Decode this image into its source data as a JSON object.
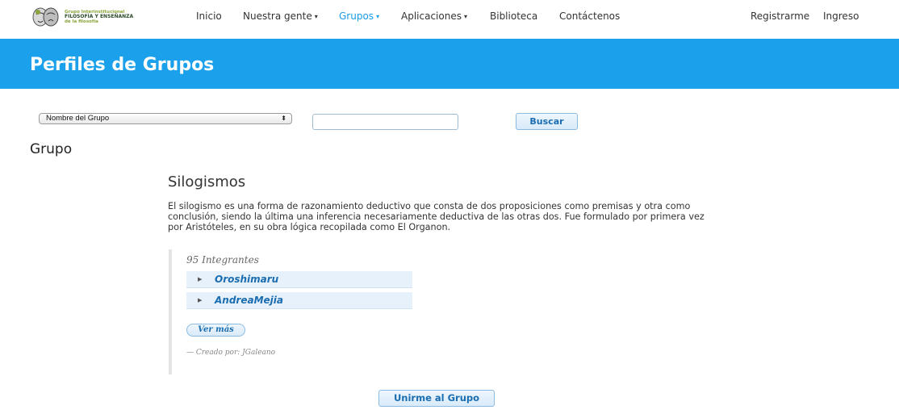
{
  "header": {
    "logo": {
      "line1": "Grupo Interinstitucional",
      "line2": "FILOSOFÍA Y ENSEÑANZA",
      "line3": "de la filosofía"
    },
    "nav": [
      {
        "label": "Inicio",
        "dropdown": false,
        "active": false
      },
      {
        "label": "Nuestra gente",
        "dropdown": true,
        "active": false
      },
      {
        "label": "Grupos",
        "dropdown": true,
        "active": true
      },
      {
        "label": "Aplicaciones",
        "dropdown": true,
        "active": false
      },
      {
        "label": "Biblioteca",
        "dropdown": false,
        "active": false
      },
      {
        "label": "Contáctenos",
        "dropdown": false,
        "active": false
      }
    ],
    "register_label": "Registrarme",
    "login_label": "Ingreso",
    "active_color": "#1a9be8"
  },
  "banner": {
    "title": "Perfiles de Grupos",
    "color": "#1ba1ec"
  },
  "search": {
    "filter_selected": "Nombre del Grupo",
    "query_value": "",
    "button_label": "Buscar"
  },
  "section": {
    "heading": "Grupo"
  },
  "group": {
    "title": "Silogismos",
    "description": "El silogismo es una forma de razonamiento deductivo que consta de dos proposiciones como premisas y otra como conclusión, siendo la última una inferencia necesariamente deductiva de las otras dos. Fue formulado por primera vez por Aristóteles, en su obra lógica recopilada como El Organon.",
    "members_count": "95 Integrantes",
    "members": [
      "Oroshimaru",
      "AndreaMejia"
    ],
    "more_label": "Ver más",
    "created_by": "— Creado por: JGaleano",
    "join_label": "Unirme al Grupo"
  }
}
